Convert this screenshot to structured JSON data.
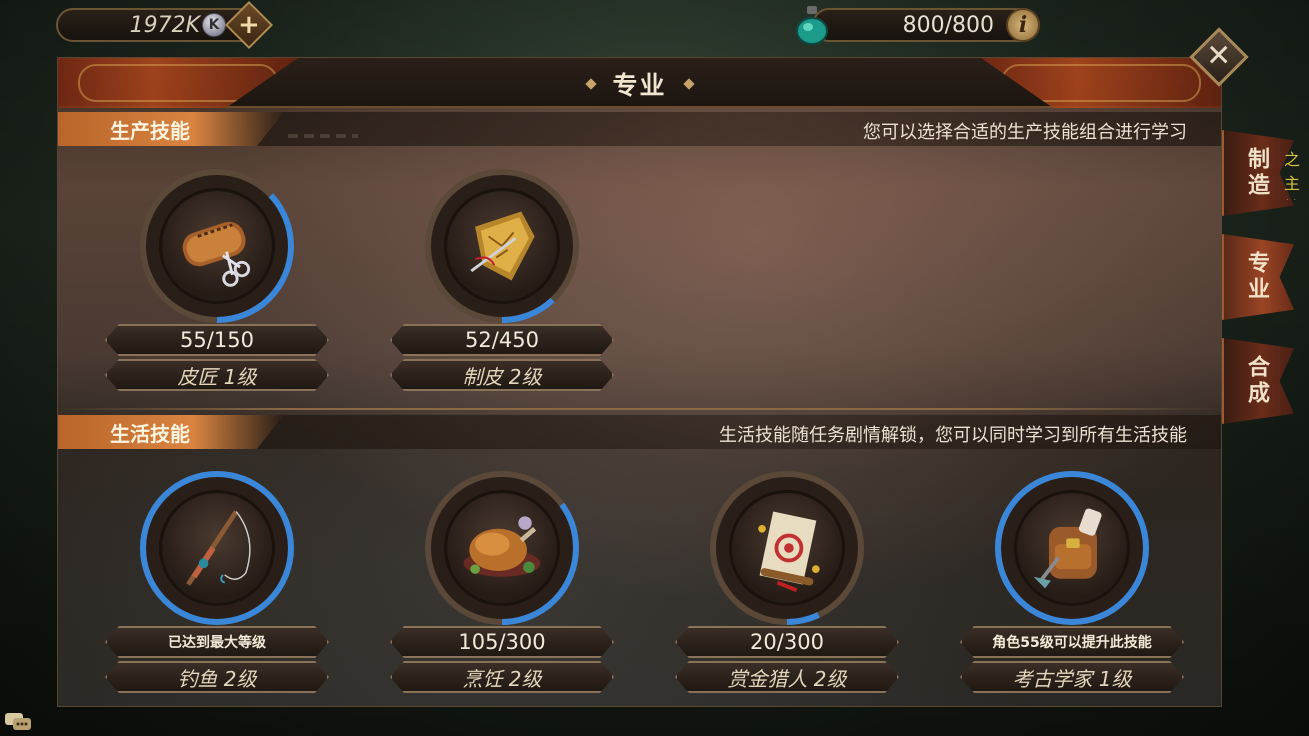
{
  "top_bar": {
    "k_currency": "1972K",
    "k_badge": "K",
    "plus": "+",
    "energy": "800/800",
    "info": "i"
  },
  "panel": {
    "title": "专业",
    "close": "✕"
  },
  "production": {
    "label": "生产技能",
    "description": "您可以选择合适的生产技能组合进行学习",
    "skills": [
      {
        "progress": "55/150",
        "name": "皮匠  1级",
        "ratio": 0.37,
        "icon": "leather-roll-scissors-icon"
      },
      {
        "progress": "52/450",
        "name": "制皮  2级",
        "ratio": 0.12,
        "icon": "leather-shield-needle-icon"
      }
    ]
  },
  "life": {
    "label": "生活技能",
    "description": "生活技能随任务剧情解锁，您可以同时学习到所有生活技能",
    "skills": [
      {
        "progress": "已达到最大等级",
        "name": "钓鱼  2级",
        "ratio": 1.0,
        "icon": "fishing-rod-icon"
      },
      {
        "progress": "105/300",
        "name": "烹饪  2级",
        "ratio": 0.35,
        "icon": "roast-chicken-icon"
      },
      {
        "progress": "20/300",
        "name": "赏金猎人  2级",
        "ratio": 0.07,
        "icon": "bounty-scroll-icon"
      },
      {
        "progress": "角色55级可以提升此技能",
        "name": "考古学家  1级",
        "ratio": 1.0,
        "icon": "backpack-shovel-icon"
      }
    ]
  },
  "side_tabs": [
    {
      "label": "制造",
      "active": false
    },
    {
      "label": "专业",
      "active": true
    },
    {
      "label": "合成",
      "active": false
    }
  ],
  "edge_text": "之主\n抽奖",
  "colors": {
    "ring_blue": "#3a86d8",
    "section_tag": "#d98440",
    "panel_border": "#8a7258"
  }
}
